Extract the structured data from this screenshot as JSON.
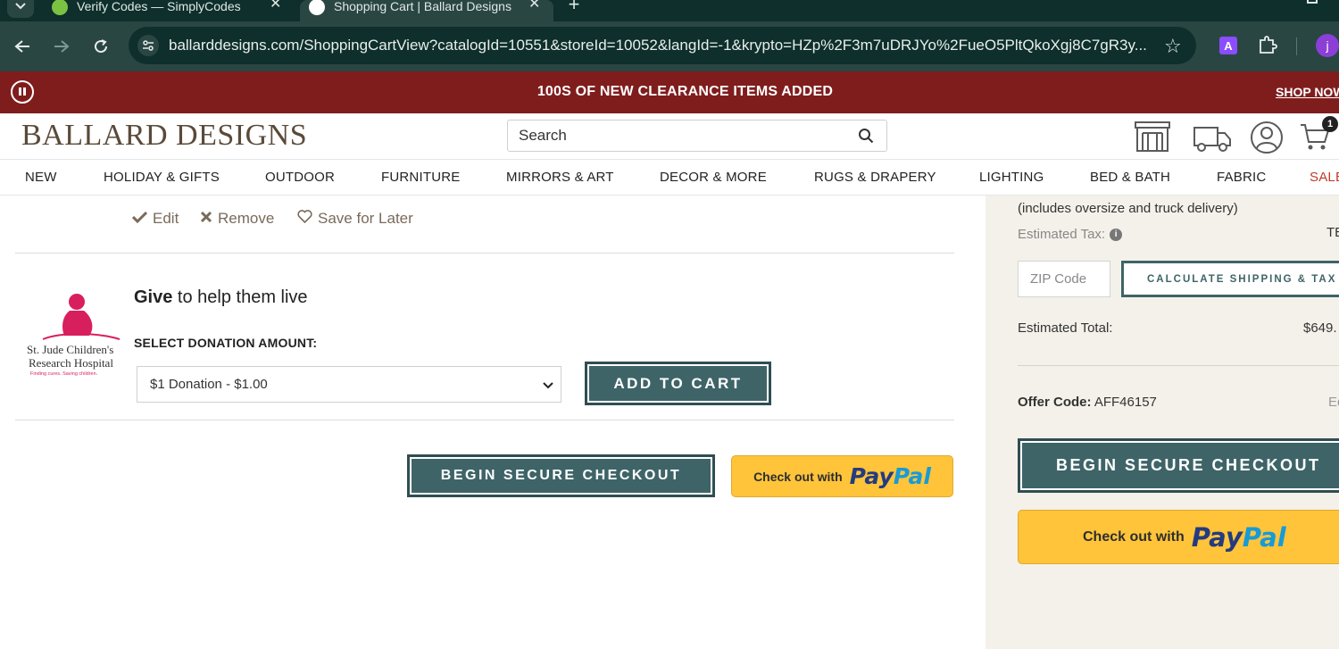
{
  "browser": {
    "tabs": [
      {
        "title": "Verify Codes — SimplyCodes",
        "active": false
      },
      {
        "title": "Shopping Cart | Ballard Designs",
        "active": true
      }
    ],
    "new_tab_symbol": "+",
    "url": "ballarddesigns.com/ShoppingCartView?catalogId=10551&storeId=10052&langId=-1&krypto=HZp%2F3m7uDRJYo%2FueO5PltQkoXgj8C7gR3y...",
    "profile_initial": "j",
    "extension_letter": "A"
  },
  "promo": {
    "text": "100S OF NEW CLEARANCE ITEMS ADDED",
    "shop_now": "SHOP NOW"
  },
  "header": {
    "logo": "BALLARD DESIGNS",
    "search_placeholder": "Search",
    "cart_count": "1"
  },
  "nav": {
    "items": [
      "NEW",
      "HOLIDAY & GIFTS",
      "OUTDOOR",
      "FURNITURE",
      "MIRRORS & ART",
      "DECOR & MORE",
      "RUGS & DRAPERY",
      "LIGHTING",
      "BED & BATH",
      "FABRIC",
      "SALE"
    ]
  },
  "cart_item_actions": {
    "edit": "Edit",
    "remove": "Remove",
    "save_for_later": "Save for Later"
  },
  "donation": {
    "logo_line1": "St. Jude Children's",
    "logo_line2": "Research Hospital",
    "logo_tagline": "Finding cures. Saving children.",
    "give_bold": "Give",
    "give_rest": " to help them live",
    "select_label": "SELECT DONATION AMOUNT:",
    "selected_option": "$1 Donation - $1.00",
    "add_to_cart": "ADD TO CART"
  },
  "checkout": {
    "begin_secure_checkout": "BEGIN SECURE CHECKOUT",
    "paypal_prefix": "Check out with",
    "paypal_pay": "Pay",
    "paypal_pal": "Pal"
  },
  "summary": {
    "shipping_note": "(includes oversize and truck delivery)",
    "estimated_tax_label": "Estimated Tax:",
    "estimated_tax_value": "TB",
    "zip_placeholder": "ZIP Code",
    "calculate_button": "CALCULATE SHIPPING & TAX",
    "estimated_total_label": "Estimated Total:",
    "estimated_total_value": "$649.",
    "offer_code_label": "Offer Code:",
    "offer_code_value": "AFF46157",
    "offer_edit": "Ed",
    "begin_secure_checkout": "BEGIN SECURE CHECKOUT",
    "paypal_prefix": "Check out with",
    "paypal_pay": "Pay",
    "paypal_pal": "Pal"
  },
  "colors": {
    "promo_bg": "#7f1d1d",
    "button_teal": "#3e6468",
    "paypal_yellow": "#ffc439",
    "sidebar_bg": "#f4f1ea",
    "browser_dark": "#0e2f2b"
  }
}
